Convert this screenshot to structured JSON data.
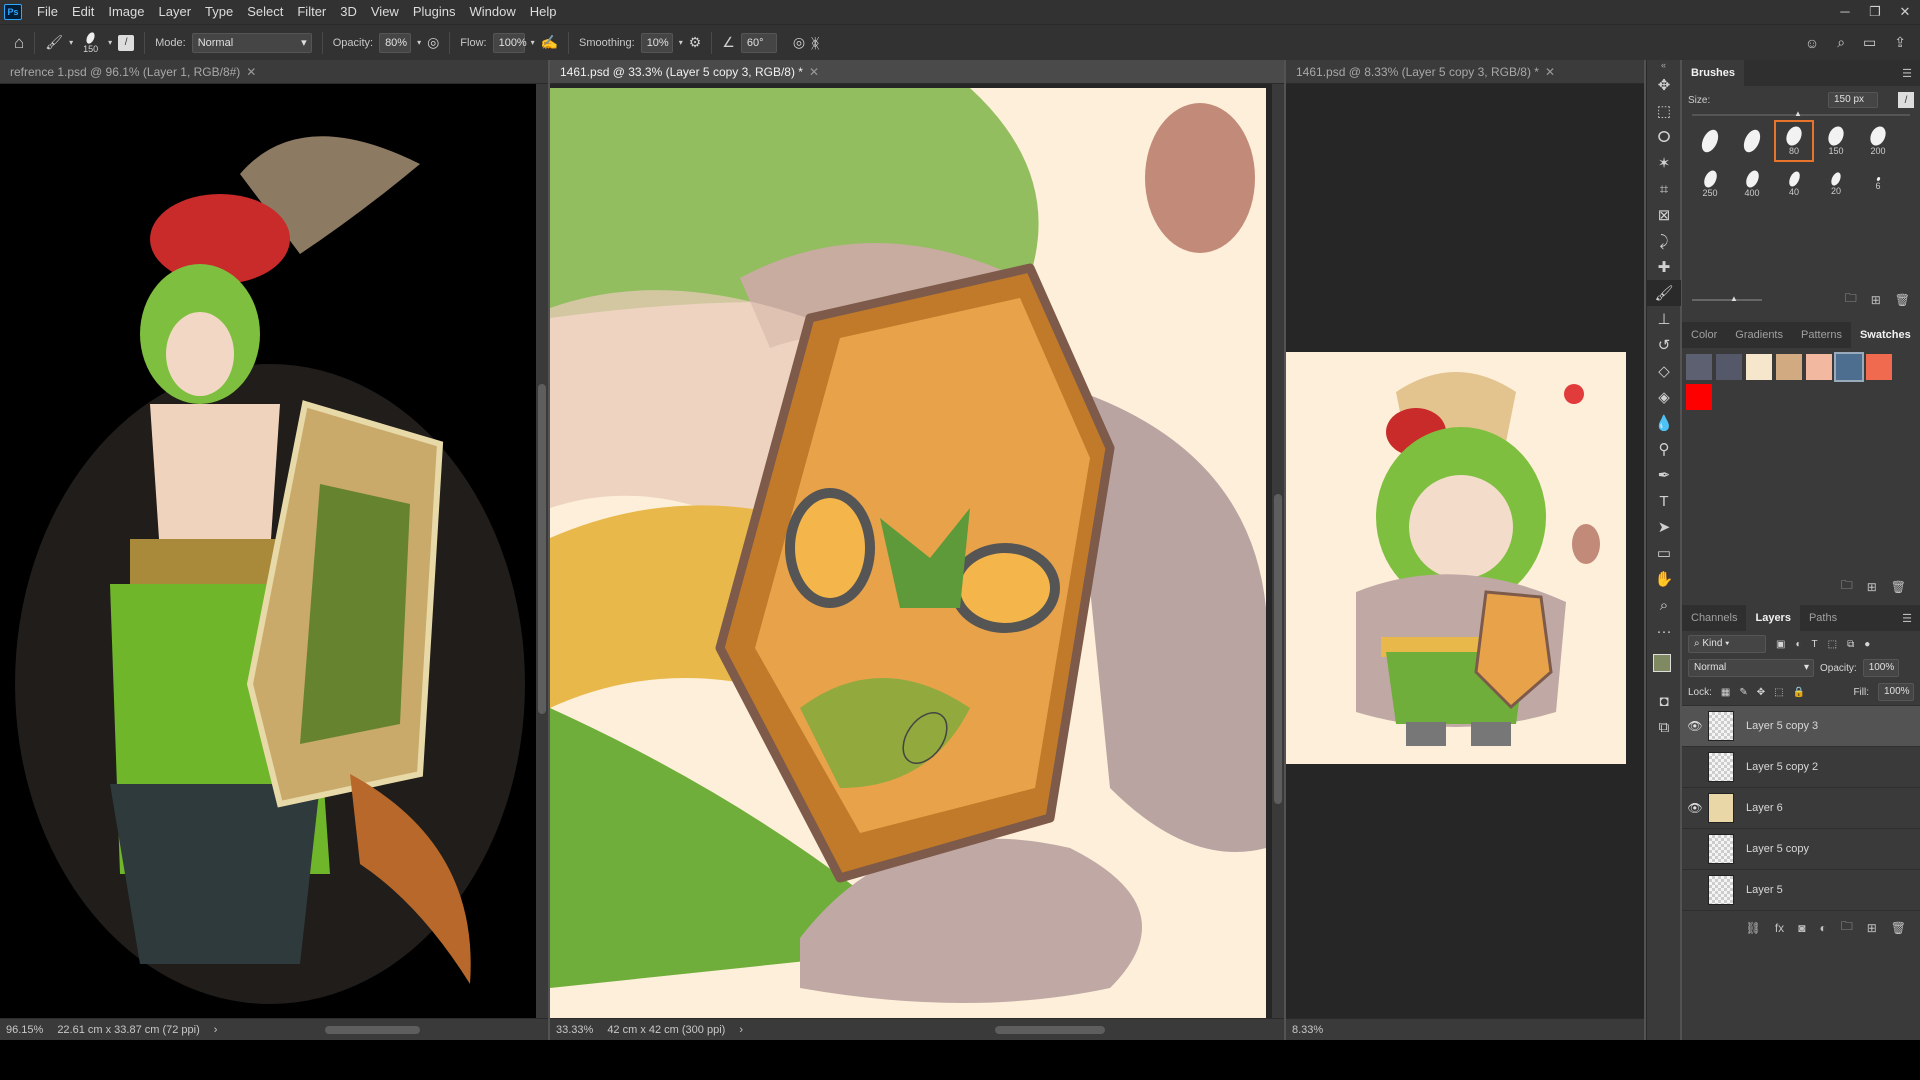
{
  "menu": {
    "items": [
      "File",
      "Edit",
      "Image",
      "Layer",
      "Type",
      "Select",
      "Filter",
      "3D",
      "View",
      "Plugins",
      "Window",
      "Help"
    ]
  },
  "options": {
    "brush_size": "150",
    "mode_label": "Mode:",
    "mode_value": "Normal",
    "opacity_label": "Opacity:",
    "opacity_value": "80%",
    "flow_label": "Flow:",
    "flow_value": "100%",
    "smoothing_label": "Smoothing:",
    "smoothing_value": "10%",
    "angle_value": "60°"
  },
  "docs": [
    {
      "tab": "refrence 1.psd @ 96.1% (Layer 1, RGB/8#)",
      "zoom": "96.15%",
      "size": "22.61 cm x 33.87 cm (72 ppi)"
    },
    {
      "tab": "1461.psd @ 33.3% (Layer 5 copy 3, RGB/8) *",
      "zoom": "33.33%",
      "size": "42 cm x 42 cm (300 ppi)"
    },
    {
      "tab": "1461.psd @ 8.33% (Layer 5 copy 3, RGB/8) *",
      "zoom": "8.33%"
    }
  ],
  "brushes": {
    "title": "Brushes",
    "size_label": "Size:",
    "size_value": "150 px",
    "presets": [
      "",
      "",
      "80",
      "150",
      "200",
      "250",
      "400",
      "40",
      "20",
      "6"
    ]
  },
  "swatch_tabs": [
    "Color",
    "Gradients",
    "Patterns",
    "Swatches"
  ],
  "swatches": [
    "#5c6070",
    "#545868",
    "#f6e6cc",
    "#d2aa82",
    "#f2b8a0",
    "#4e6e90",
    "#f06a50",
    "#ff0000"
  ],
  "layers": {
    "tabs": [
      "Channels",
      "Layers",
      "Paths"
    ],
    "filter": "Kind",
    "blend": "Normal",
    "opacity_label": "Opacity:",
    "opacity_value": "100%",
    "lock_label": "Lock:",
    "fill_label": "Fill:",
    "fill_value": "100%",
    "rows": [
      {
        "name": "Layer 5 copy 3",
        "visible": true
      },
      {
        "name": "Layer 5 copy 2",
        "visible": false
      },
      {
        "name": "Layer 6",
        "visible": true
      },
      {
        "name": "Layer 5 copy",
        "visible": false
      },
      {
        "name": "Layer 5",
        "visible": false
      }
    ]
  }
}
